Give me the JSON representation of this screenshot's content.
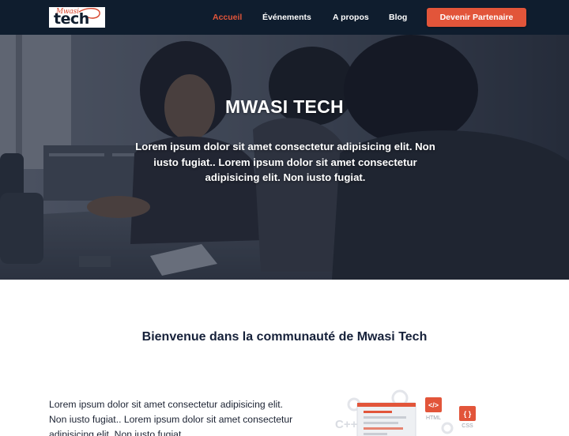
{
  "brand": {
    "logo_small": "Mwasi",
    "logo_main": "tech"
  },
  "nav": {
    "links": [
      "Accueil",
      "Événements",
      "A propos",
      "Blog"
    ],
    "active_index": 0,
    "cta_label": "Devenir Partenaire"
  },
  "hero": {
    "title": "MWASI TECH",
    "text": "Lorem ipsum dolor sit amet consectetur adipisicing elit. Non iusto fugiat.. Lorem ipsum dolor sit amet consectetur adipisicing elit. Non iusto fugiat."
  },
  "welcome": {
    "title": "Bienvenue dans la communauté de Mwasi Tech",
    "intro": "Lorem ipsum dolor sit amet consectetur adipisicing elit. Non iusto fugiat.. Lorem ipsum dolor sit amet consectetur adipisicing elit. Non iusto fugiat."
  },
  "illustration": {
    "labels": [
      "</>",
      "HTML",
      "{ }",
      "CSS",
      "C++"
    ]
  },
  "colors": {
    "navbar_bg": "#0f1d2e",
    "accent": "#e2553a",
    "heading": "#16213a"
  }
}
